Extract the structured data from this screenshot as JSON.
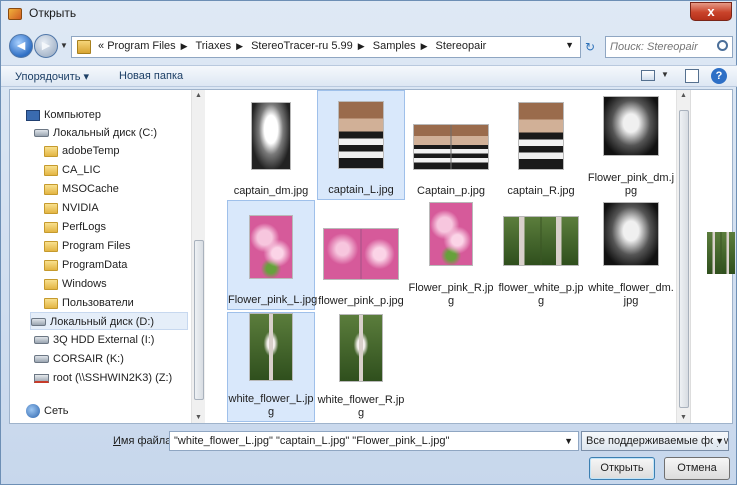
{
  "window": {
    "title": "Открыть",
    "close_label": "x"
  },
  "nav": {
    "back": "◄",
    "forward": "►",
    "breadcrumb_prefix": "«",
    "breadcrumbs": [
      "Program Files",
      "Triaxes",
      "StereoTracer-ru 5.99",
      "Samples",
      "Stereopair"
    ],
    "search_placeholder": "Поиск: Stereopair"
  },
  "toolbar": {
    "organize": "Упорядочить ▾",
    "new_folder": "Новая папка"
  },
  "sidebar": {
    "items": [
      {
        "label": "Компьютер",
        "icon": "computer-icon"
      },
      {
        "label": "Локальный диск (C:)",
        "icon": "drive-icon"
      },
      {
        "label": "adobeTemp",
        "icon": "folder-icon"
      },
      {
        "label": "CA_LIC",
        "icon": "folder-icon"
      },
      {
        "label": "MSOCache",
        "icon": "folder-icon"
      },
      {
        "label": "NVIDIA",
        "icon": "folder-icon"
      },
      {
        "label": "PerfLogs",
        "icon": "folder-icon"
      },
      {
        "label": "Program Files",
        "icon": "folder-icon"
      },
      {
        "label": "ProgramData",
        "icon": "folder-icon"
      },
      {
        "label": "Windows",
        "icon": "folder-icon"
      },
      {
        "label": "Пользователи",
        "icon": "folder-icon"
      },
      {
        "label": "Локальный диск (D:)",
        "icon": "drive-icon",
        "selected": true
      },
      {
        "label": "3Q HDD External (I:)",
        "icon": "drive-icon"
      },
      {
        "label": "CORSAIR (K:)",
        "icon": "drive-icon"
      },
      {
        "label": "root (\\\\SSHWIN2K3) (Z:)",
        "icon": "netdrive-icon"
      },
      {
        "label": "Сеть",
        "icon": "network-icon"
      }
    ]
  },
  "files": [
    {
      "name": "captain_dm.jpg",
      "thumb": "th-bw",
      "selected": false
    },
    {
      "name": "captain_L.jpg",
      "thumb": "th-captain",
      "selected": true
    },
    {
      "name": "Captain_p.jpg",
      "thumb": "th-captain2",
      "selected": false
    },
    {
      "name": "captain_R.jpg",
      "thumb": "th-captain",
      "selected": false
    },
    {
      "name": "Flower_pink_dm.j pg",
      "thumb": "th-flower-bw",
      "selected": false
    },
    {
      "name": "Flower_pink_L.jpg",
      "thumb": "th-flower",
      "selected": true
    },
    {
      "name": "flower_pink_p.jpg",
      "thumb": "th-flower2",
      "selected": false
    },
    {
      "name": "Flower_pink_R.jp g",
      "thumb": "th-flower",
      "selected": false
    },
    {
      "name": "flower_white_p.jp g",
      "thumb": "th-lupin2",
      "selected": false
    },
    {
      "name": "white_flower_dm. jpg",
      "thumb": "th-flower-bw",
      "selected": false
    },
    {
      "name": "white_flower_L.jp g",
      "thumb": "th-lupin",
      "selected": true
    },
    {
      "name": "white_flower_R.jp g",
      "thumb": "th-lupin",
      "selected": false
    }
  ],
  "bottom": {
    "filename_label_u": "И",
    "filename_label_rest": "мя файла:",
    "filename_value": "\"white_flower_L.jpg\" \"captain_L.jpg\" \"Flower_pink_L.jpg\"",
    "filter_value": "Все поддерживаемые форм",
    "open_label": "Открыть",
    "cancel_label": "Отмена"
  }
}
